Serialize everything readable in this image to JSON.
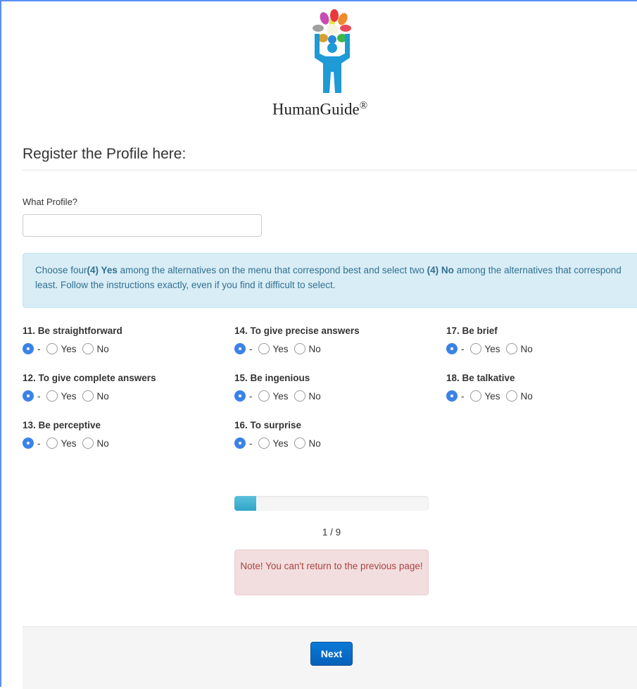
{
  "brand": {
    "name": "HumanGuide",
    "mark": "®"
  },
  "page": {
    "heading": "Register the Profile here:"
  },
  "profile_field": {
    "label": "What Profile?",
    "value": "",
    "placeholder": ""
  },
  "instructions": {
    "p1": "Choose four",
    "b1": "(4) Yes",
    "p2": " among the alternatives on the menu that correspond best and select two ",
    "b2": "(4) No",
    "p3": " among the alternatives that correspond least. Follow the instructions exactly, even if you find it difficult to select."
  },
  "option_labels": {
    "none": "-",
    "yes": "Yes",
    "no": "No"
  },
  "questions": [
    {
      "title": "11. Be straightforward",
      "selected": "-"
    },
    {
      "title": "12. To give complete answers",
      "selected": "-"
    },
    {
      "title": "13. Be perceptive",
      "selected": "-"
    },
    {
      "title": "14. To give precise answers",
      "selected": "-"
    },
    {
      "title": "15. Be ingenious",
      "selected": "-"
    },
    {
      "title": "16. To surprise",
      "selected": "-"
    },
    {
      "title": "17. Be brief",
      "selected": "-"
    },
    {
      "title": "18. Be talkative",
      "selected": "-"
    }
  ],
  "progress": {
    "current": 1,
    "total": 9,
    "label": "1 / 9",
    "fraction": 0.111
  },
  "alert": {
    "text": "Note! You can't return to the previous page!"
  },
  "buttons": {
    "next": "Next"
  },
  "colors": {
    "accent": "#3b82e8",
    "info_bg": "#d9edf7",
    "alert_bg": "#f2dede",
    "button": "#0a6fd0",
    "progress": "#5bc0de"
  }
}
